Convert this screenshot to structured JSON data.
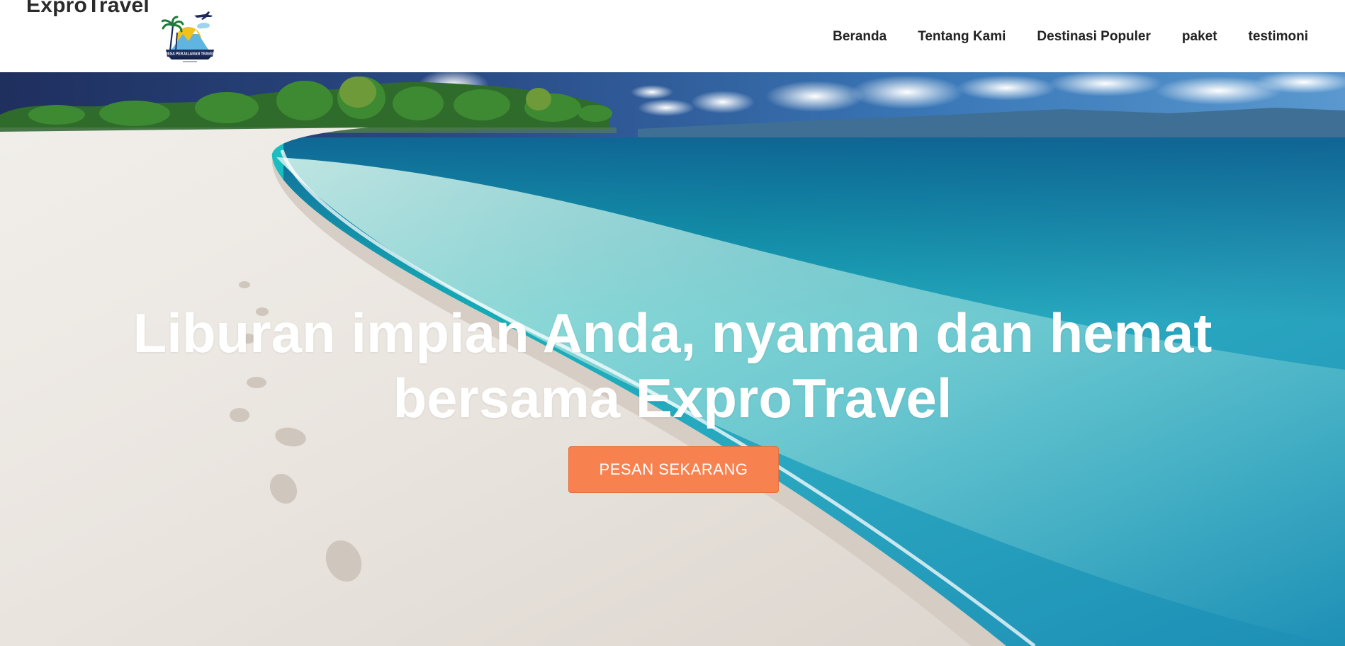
{
  "header": {
    "brand_name": "ExproTravel",
    "logo_text": "DESA PERJALANAN TRAVEL",
    "nav": [
      {
        "label": "Beranda",
        "name": "nav-beranda"
      },
      {
        "label": "Tentang Kami",
        "name": "nav-tentang-kami"
      },
      {
        "label": "Destinasi Populer",
        "name": "nav-destinasi-populer"
      },
      {
        "label": "paket",
        "name": "nav-paket"
      },
      {
        "label": "testimoni",
        "name": "nav-testimoni"
      }
    ]
  },
  "hero": {
    "title_line1": "Liburan impian Anda, nyaman dan hemat",
    "title_line2": "bersama ExproTravel",
    "cta_label": "PESAN SEKARANG"
  },
  "colors": {
    "cta": "#f7824f",
    "nav_text": "#222222",
    "hero_text": "#ffffff"
  }
}
